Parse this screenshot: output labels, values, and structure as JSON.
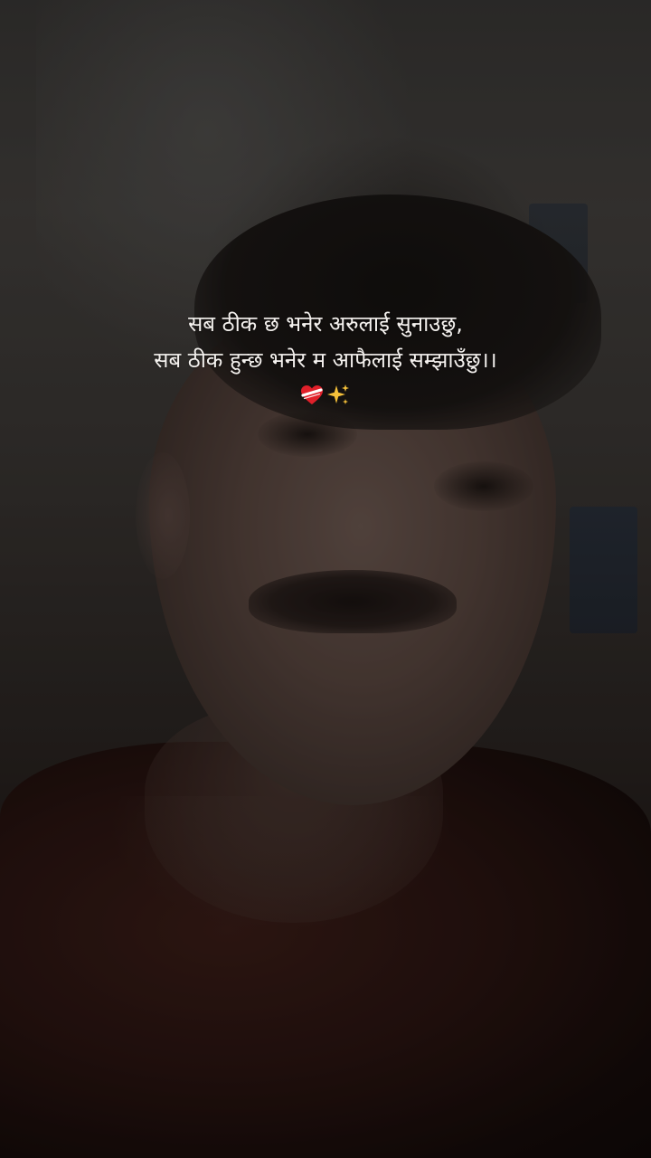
{
  "story": {
    "caption_lines": [
      "सब ठीक छ भनेर अरुलाई सुनाउछु,",
      "सब ठीक हुन्छ भनेर म आफैलाई सम्झाउँछु।।"
    ],
    "emojis": [
      "mending-heart-icon",
      "sparkles-icon"
    ],
    "colors": {
      "caption_text": "#f4f1ee",
      "heart_red": "#e0202a",
      "sparkle_yellow": "#f6c13a"
    }
  }
}
